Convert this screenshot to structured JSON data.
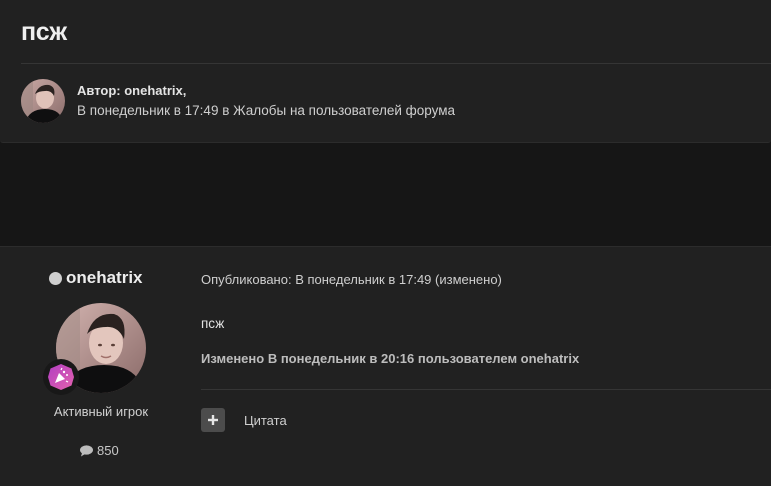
{
  "topic": {
    "title": "псж",
    "author_line": "Автор: onehatrix,",
    "meta_line": "В понедельник в 17:49 в Жалобы на пользователей форума"
  },
  "post": {
    "username": "onehatrix",
    "user_title": "Активный игрок",
    "post_count": "850",
    "published": "Опубликовано: В понедельник в 17:49 (изменено)",
    "content": "псж",
    "edited_note": "Изменено В понедельник в 20:16 пользователем onehatrix",
    "quote_label": "Цитата"
  },
  "icons": {
    "status": "online-status-dot",
    "rank_badge": "confetti-badge-icon",
    "posts": "speech-bubble-icon",
    "quote": "plus-icon"
  },
  "colors": {
    "background": "#161616",
    "panel": "#212121",
    "badge_gradient_start": "#b13ec2",
    "badge_gradient_end": "#e462ae"
  }
}
